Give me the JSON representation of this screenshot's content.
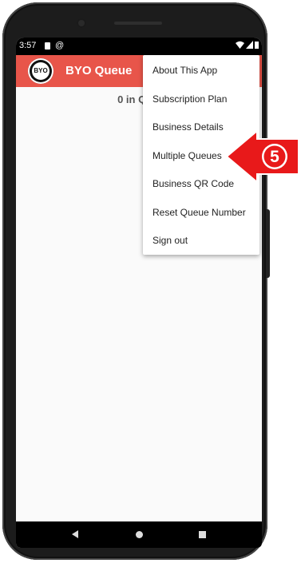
{
  "status_bar": {
    "time": "3:57",
    "left_icons": [
      "sim-card-icon",
      "at-sign-icon"
    ],
    "right_icons": [
      "wifi-icon",
      "signal-icon",
      "battery-icon"
    ]
  },
  "app_bar": {
    "logo_text": "BYO",
    "title": "BYO Queue",
    "color": "#e8554a"
  },
  "main": {
    "queue_status": "0 in Queue (C"
  },
  "menu": {
    "items": [
      {
        "label": "About This App"
      },
      {
        "label": "Subscription Plan"
      },
      {
        "label": "Business Details"
      },
      {
        "label": "Multiple Queues"
      },
      {
        "label": "Business QR Code"
      },
      {
        "label": "Reset Queue Number"
      },
      {
        "label": "Sign out"
      }
    ]
  },
  "callout": {
    "number": "5",
    "color": "#e8191a"
  },
  "nav_bar": {
    "icons": [
      "back-icon",
      "home-icon",
      "recents-icon"
    ]
  }
}
